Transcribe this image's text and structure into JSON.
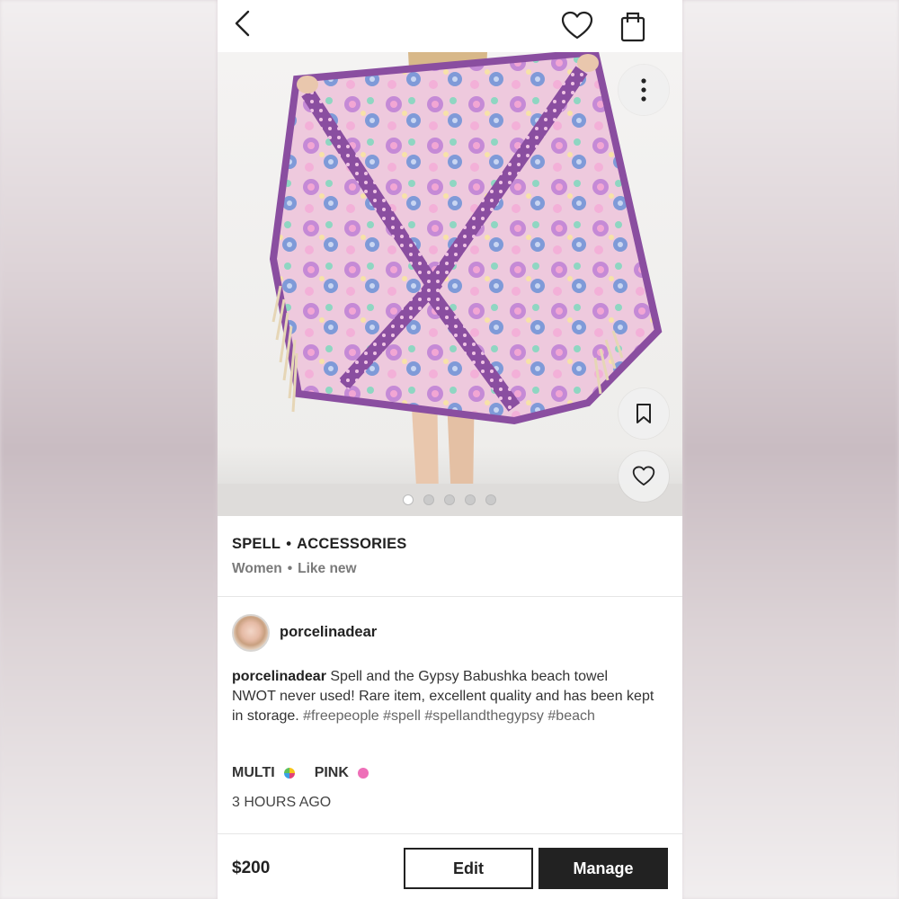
{
  "top_bar": {
    "back_icon": "chevron-left-icon",
    "like_icon": "heart-icon",
    "bag_icon": "shopping-bag-icon"
  },
  "gallery": {
    "image_count": 5,
    "active_index": 0,
    "more_icon": "more-vertical-icon",
    "save_icon": "bookmark-icon",
    "like_icon": "heart-icon"
  },
  "listing": {
    "brand": "SPELL",
    "separator": "•",
    "category": "ACCESSORIES",
    "department": "Women",
    "condition": "Like new"
  },
  "seller": {
    "username": "porcelinadear"
  },
  "description": {
    "author": "porcelinadear",
    "text": " Spell and the Gypsy Babushka beach towel NWOT never used! Rare item, excellent quality and has been kept in storage. ",
    "hashtags": [
      "#freepeople",
      "#spell",
      "#spellandthegypsy",
      "#beach"
    ]
  },
  "colors": [
    {
      "label": "MULTI",
      "swatch": "multi"
    },
    {
      "label": "PINK",
      "swatch": "#ee6fb8"
    }
  ],
  "posted": "3 HOURS AGO",
  "footer": {
    "price": "$200",
    "edit_label": "Edit",
    "manage_label": "Manage"
  }
}
